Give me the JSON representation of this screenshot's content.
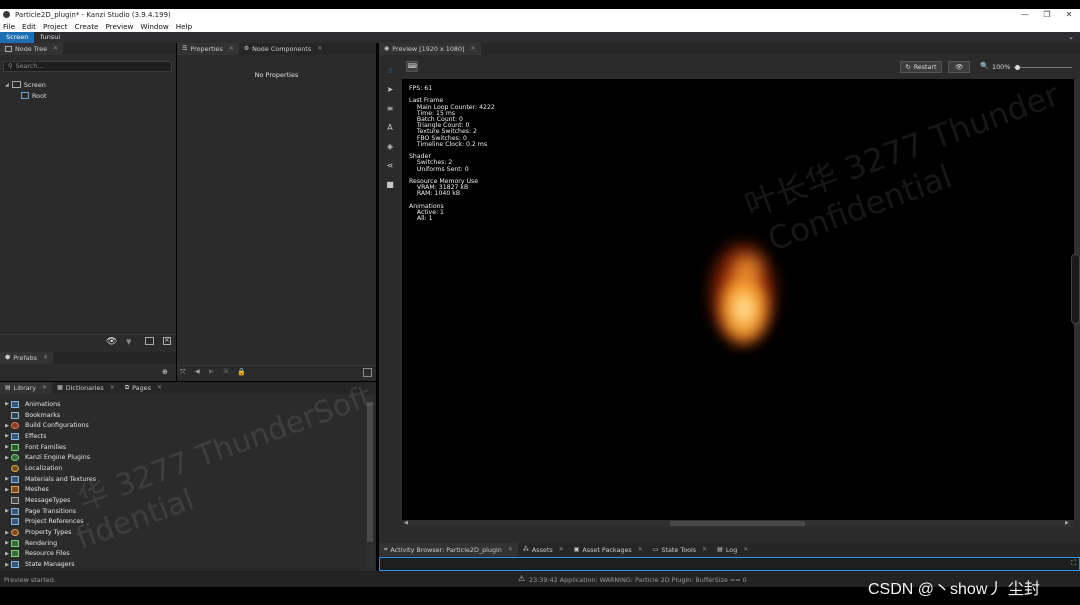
{
  "window": {
    "title": "Particle2D_plugin* - Kanzi Studio (3.9.4.199)",
    "controls": [
      "—",
      "❐",
      "✕"
    ]
  },
  "menu": [
    "File",
    "Edit",
    "Project",
    "Create",
    "Preview",
    "Window",
    "Help"
  ],
  "workspaces": [
    "Screen",
    "funsui"
  ],
  "node_tree": {
    "tab": "Node Tree",
    "search_placeholder": "Search...",
    "items": [
      {
        "label": "Screen",
        "icon": "monitor-icon"
      },
      {
        "label": "Root",
        "icon": "node-icon"
      }
    ]
  },
  "properties": {
    "tabs": [
      "Properties",
      "Node Components"
    ],
    "empty_text": "No Properties"
  },
  "prefabs": {
    "tab": "Prefabs"
  },
  "library": {
    "tabs": [
      "Library",
      "Dictionaries",
      "Pages"
    ],
    "items": [
      {
        "label": "Animations",
        "expandable": true
      },
      {
        "label": "Bookmarks",
        "expandable": false
      },
      {
        "label": "Build Configurations",
        "expandable": true
      },
      {
        "label": "Effects",
        "expandable": true
      },
      {
        "label": "Font Families",
        "expandable": true
      },
      {
        "label": "Kanzi Engine Plugins",
        "expandable": true
      },
      {
        "label": "Localization",
        "expandable": false
      },
      {
        "label": "Materials and Textures",
        "expandable": true
      },
      {
        "label": "Meshes",
        "expandable": true
      },
      {
        "label": "MessageTypes",
        "expandable": false
      },
      {
        "label": "Page Transitions",
        "expandable": true
      },
      {
        "label": "Project References",
        "expandable": false
      },
      {
        "label": "Property Types",
        "expandable": true
      },
      {
        "label": "Rendering",
        "expandable": true
      },
      {
        "label": "Resource Files",
        "expandable": true
      },
      {
        "label": "State Managers",
        "expandable": true
      }
    ]
  },
  "preview": {
    "tab": "Preview [1920 x 1080]",
    "restart_label": "Restart",
    "zoom": "100%",
    "zoom_level": 0.02,
    "stats": [
      "FPS: 61",
      "",
      "Last Frame",
      "    Main Loop Counter: 4222",
      "    Time: 15 ms",
      "    Batch Count: 0",
      "    Triangle Count: 0",
      "    Texture Switches: 2",
      "    FBO Switches: 0",
      "    Timeline Clock: 0.2 ms",
      "",
      "Shader",
      "    Switches: 2",
      "    Uniforms Sent: 0",
      "",
      "Resource Memory Use",
      "    VRAM: 31827 kB",
      "    RAM: 1040 kB",
      "",
      "Animations",
      "    Active: 1",
      "    All: 1"
    ],
    "watermark_line1": "叶长华 3277 Thunder",
    "watermark_line2": "Confidential"
  },
  "watermark_left": {
    "line1": "华 3277 ThunderSoft",
    "line2": "fidential"
  },
  "bottom_tabs": [
    "Activity Browser: Particle2D_plugin",
    "Assets",
    "Asset Packages",
    "State Tools",
    "Log"
  ],
  "status": {
    "left": "Preview started.",
    "message": "23:39:42 Application: WARNING: Particle 2D Plugin: BufferSize == 0"
  },
  "overlay_credit": "CSDN @丶show丿 尘封"
}
